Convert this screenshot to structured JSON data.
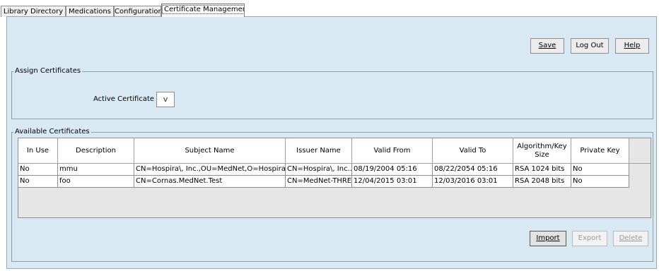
{
  "tabs": [
    {
      "label": "Library Directory"
    },
    {
      "label": "Medications"
    },
    {
      "label": "Configuration"
    },
    {
      "label": "Certificate Management"
    }
  ],
  "toolbar": {
    "save_label": "Save",
    "logout_label": "Log Out",
    "help_label": "Help"
  },
  "assign": {
    "title": "Assign Certificates",
    "active_label": "Active Certificate",
    "combo_arrow": "v"
  },
  "available": {
    "title": "Available Certificates",
    "columns": [
      "In Use",
      "Description",
      "Subject Name",
      "Issuer Name",
      "Valid From",
      "Valid To",
      "Algorithm/Key Size",
      "Private Key"
    ],
    "rows": [
      [
        "No",
        "mmu",
        "CN=Hospira\\, Inc.,OU=MedNet,O=Hospira\\,...",
        "CN=Hospira\\, Inc....",
        "08/19/2004 05:16",
        "08/22/2054 05:16",
        "RSA 1024 bits",
        "No"
      ],
      [
        "No",
        "foo",
        "CN=Cornas.MedNet.Test",
        "CN=MedNet-THRE...",
        "12/04/2015 03:01",
        "12/03/2016 03:01",
        "RSA 2048 bits",
        "No"
      ]
    ],
    "import_label": "Import",
    "export_label": "Export",
    "delete_label": "Delete"
  },
  "colors": {
    "panel_bg": "#d9e9f3"
  }
}
